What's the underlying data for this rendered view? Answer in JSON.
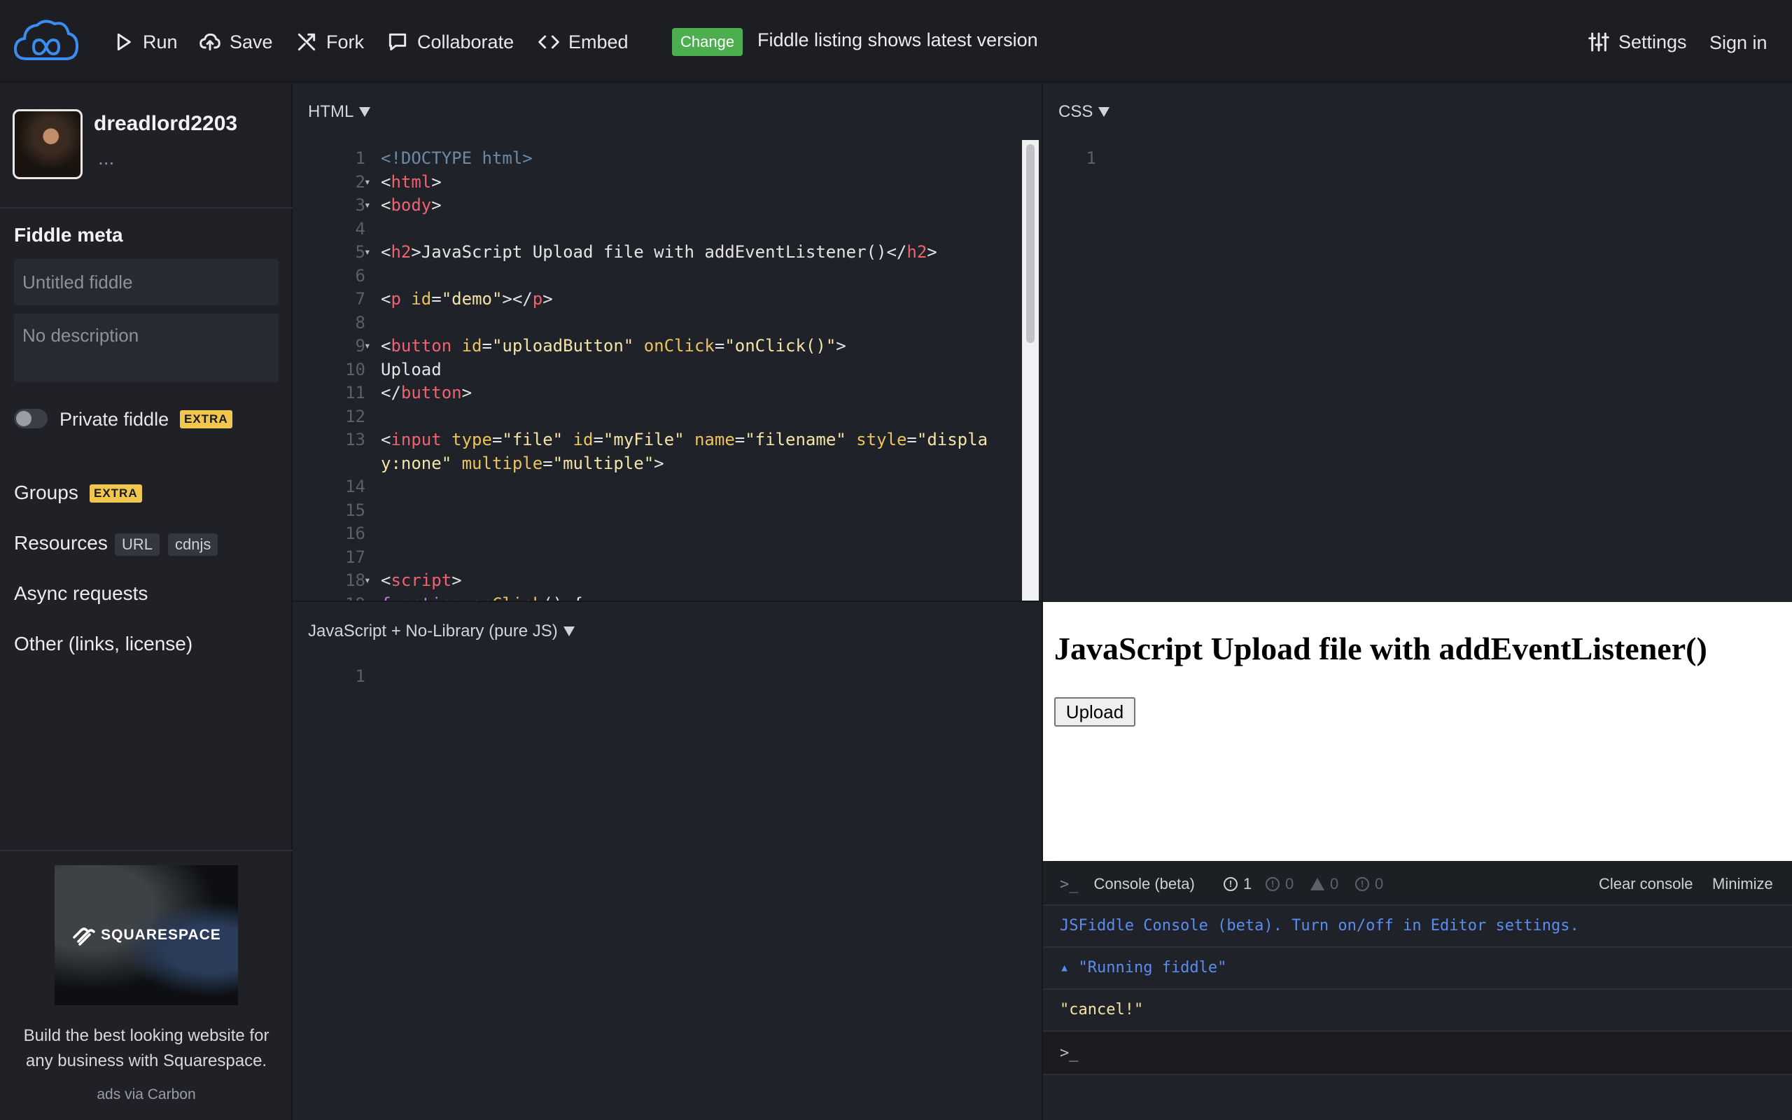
{
  "topbar": {
    "run": "Run",
    "save": "Save",
    "fork": "Fork",
    "collaborate": "Collaborate",
    "embed": "Embed",
    "change_badge": "Change",
    "notice": "Fiddle listing shows latest version",
    "settings": "Settings",
    "sign_in": "Sign in"
  },
  "sidebar": {
    "username": "dreadlord2203",
    "user_more": "...",
    "meta_title": "Fiddle meta",
    "title_placeholder": "Untitled fiddle",
    "description_placeholder": "No description",
    "private_label": "Private fiddle",
    "extra_badge": "EXTRA",
    "groups": "Groups",
    "resources": "Resources",
    "resources_url": "URL",
    "resources_cdnjs": "cdnjs",
    "async": "Async requests",
    "other": "Other (links, license)",
    "ad_brand": "SQUARESPACE",
    "ad_text": "Build the best looking website for any business with Squarespace.",
    "ad_via": "ads via Carbon"
  },
  "editors": {
    "html_label": "HTML",
    "css_label": "CSS",
    "js_label": "JavaScript + No-Library (pure JS)",
    "css_line": "1",
    "js_line": "1"
  },
  "result": {
    "heading": "JavaScript Upload file with addEventListener()",
    "button": "Upload"
  },
  "console": {
    "title": "Console (beta)",
    "count_errors": "1",
    "count_info": "0",
    "count_warn": "0",
    "count_log": "0",
    "clear": "Clear console",
    "minimize": "Minimize",
    "lines": [
      "JSFiddle Console (beta). Turn on/off in Editor settings.",
      "▴ \"Running fiddle\"",
      "\"cancel!\""
    ],
    "prompt": ">_"
  }
}
